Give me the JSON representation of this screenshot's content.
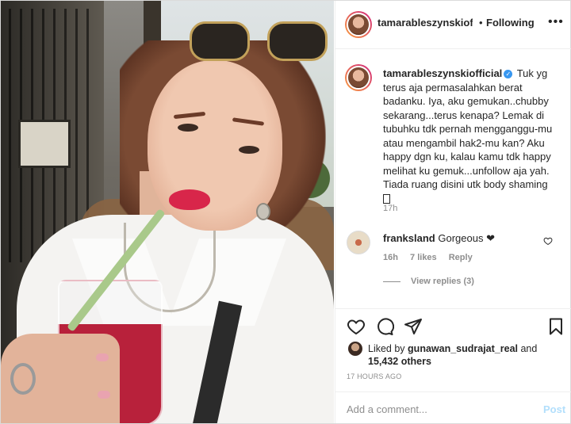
{
  "header": {
    "username": "tamarableszynskiofficial",
    "separator": "•",
    "follow_status": "Following",
    "more_label": "•••"
  },
  "caption": {
    "username": "tamarableszynskiofficial",
    "text": "Tuk yg terus aja permasalahkan berat badanku. Iya, aku gemukan..chubby sekarang...terus kenapa? Lemak di tubuhku tdk pernah mengganggu-mu atau mengambil hak2-mu kan? Aku happy dgn ku, kalau kamu tdk happy melihat ku gemuk...unfollow aja yah. Tiada ruang disini utk body shaming",
    "time": "17h"
  },
  "comment": {
    "username": "franksland",
    "text": "Gorgeous ❤",
    "time": "16h",
    "likes": "7 likes",
    "reply_label": "Reply",
    "view_replies": "View replies (3)"
  },
  "likes": {
    "prefix": "Liked by",
    "user": "gunawan_sudrajat_real",
    "connector": "and",
    "others": "15,432 others"
  },
  "post_time": "17 HOURS AGO",
  "add_comment": {
    "placeholder": "Add a comment...",
    "post_label": "Post"
  },
  "colors": {
    "accent_blue": "#3897f0",
    "post_disabled": "#b2dffc",
    "muted_text": "#8e8e8e",
    "border": "#efefef"
  },
  "icons": [
    "heart-icon",
    "comment-icon",
    "share-icon",
    "bookmark-icon",
    "verified-icon",
    "more-icon"
  ]
}
